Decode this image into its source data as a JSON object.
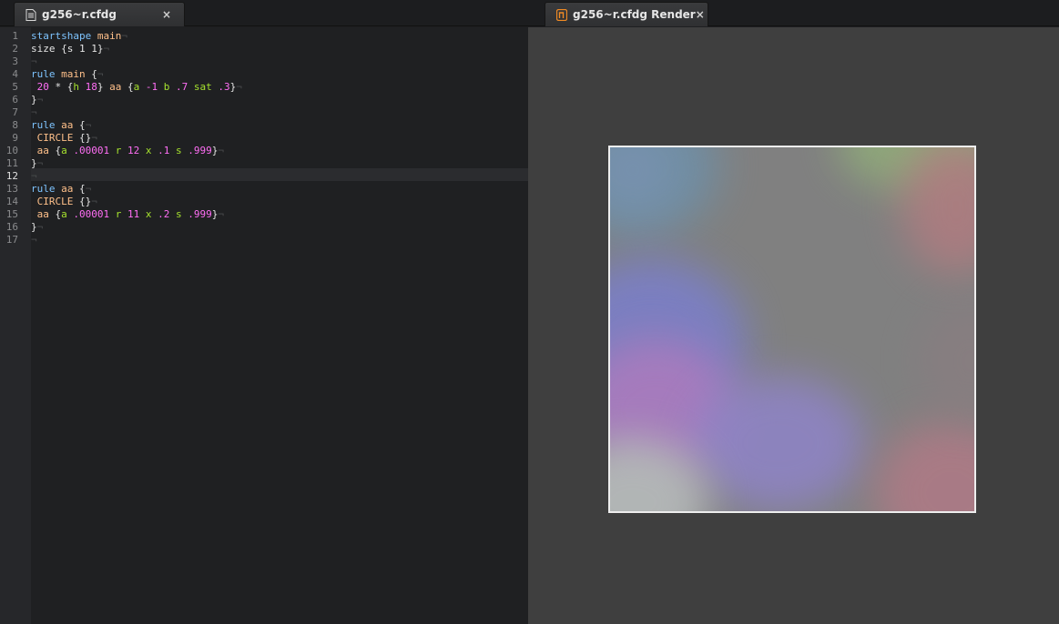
{
  "tabs": [
    {
      "label": "g256~r.cfdg",
      "icon": "document-icon",
      "close": "×"
    },
    {
      "label": "g256~r.cfdg Render",
      "icon": "render-app-icon",
      "close": "×"
    }
  ],
  "editor": {
    "active_line": 12,
    "line_numbers": [
      "1",
      "2",
      "3",
      "4",
      "5",
      "6",
      "7",
      "8",
      "9",
      "10",
      "11",
      "12",
      "13",
      "14",
      "15",
      "16",
      "17"
    ],
    "lines": [
      [
        {
          "t": "startshape",
          "c": "kw"
        },
        {
          "t": " "
        },
        {
          "t": "main",
          "c": "nm"
        }
      ],
      [
        {
          "t": "size {s 1 1}"
        }
      ],
      [],
      [
        {
          "t": "rule",
          "c": "kw"
        },
        {
          "t": " "
        },
        {
          "t": "main",
          "c": "nm"
        },
        {
          "t": " {"
        }
      ],
      [
        {
          "t": " "
        },
        {
          "t": "20",
          "c": "num"
        },
        {
          "t": " * {"
        },
        {
          "t": "h",
          "c": "key"
        },
        {
          "t": " "
        },
        {
          "t": "18",
          "c": "num"
        },
        {
          "t": "} "
        },
        {
          "t": "aa",
          "c": "id"
        },
        {
          "t": " {"
        },
        {
          "t": "a",
          "c": "key"
        },
        {
          "t": " "
        },
        {
          "t": "-1",
          "c": "num"
        },
        {
          "t": " "
        },
        {
          "t": "b",
          "c": "key"
        },
        {
          "t": " "
        },
        {
          "t": ".7",
          "c": "num"
        },
        {
          "t": " "
        },
        {
          "t": "sat",
          "c": "key"
        },
        {
          "t": " "
        },
        {
          "t": ".3",
          "c": "num"
        },
        {
          "t": "}"
        }
      ],
      [
        {
          "t": "}"
        }
      ],
      [],
      [
        {
          "t": "rule",
          "c": "kw"
        },
        {
          "t": " "
        },
        {
          "t": "aa",
          "c": "nm"
        },
        {
          "t": " {"
        }
      ],
      [
        {
          "t": " "
        },
        {
          "t": "CIRCLE",
          "c": "id"
        },
        {
          "t": " {}"
        }
      ],
      [
        {
          "t": " "
        },
        {
          "t": "aa",
          "c": "id"
        },
        {
          "t": " {"
        },
        {
          "t": "a",
          "c": "key"
        },
        {
          "t": " "
        },
        {
          "t": ".00001",
          "c": "num"
        },
        {
          "t": " "
        },
        {
          "t": "r",
          "c": "key"
        },
        {
          "t": " "
        },
        {
          "t": "12",
          "c": "num"
        },
        {
          "t": " "
        },
        {
          "t": "x",
          "c": "key"
        },
        {
          "t": " "
        },
        {
          "t": ".1",
          "c": "num"
        },
        {
          "t": " "
        },
        {
          "t": "s",
          "c": "key"
        },
        {
          "t": " "
        },
        {
          "t": ".999",
          "c": "num"
        },
        {
          "t": "}"
        }
      ],
      [
        {
          "t": "}"
        }
      ],
      [],
      [
        {
          "t": "rule",
          "c": "kw"
        },
        {
          "t": " "
        },
        {
          "t": "aa",
          "c": "nm"
        },
        {
          "t": " {"
        }
      ],
      [
        {
          "t": " "
        },
        {
          "t": "CIRCLE",
          "c": "id"
        },
        {
          "t": " {}"
        }
      ],
      [
        {
          "t": " "
        },
        {
          "t": "aa",
          "c": "id"
        },
        {
          "t": " {"
        },
        {
          "t": "a",
          "c": "key"
        },
        {
          "t": " "
        },
        {
          "t": ".00001",
          "c": "num"
        },
        {
          "t": " "
        },
        {
          "t": "r",
          "c": "key"
        },
        {
          "t": " "
        },
        {
          "t": "11",
          "c": "num"
        },
        {
          "t": " "
        },
        {
          "t": "x",
          "c": "key"
        },
        {
          "t": " "
        },
        {
          "t": ".2",
          "c": "num"
        },
        {
          "t": " "
        },
        {
          "t": "s",
          "c": "key"
        },
        {
          "t": " "
        },
        {
          "t": ".999",
          "c": "num"
        },
        {
          "t": "}"
        }
      ],
      [
        {
          "t": "}"
        }
      ],
      []
    ],
    "eol_marker": "¬"
  },
  "colors": {
    "keyword": "#7ec4ff",
    "name": "#ffc08a",
    "number": "#ff6ef5",
    "attribute": "#a6e22e",
    "render_background": "#3f3f3f",
    "render_canvas_base": "#808080"
  }
}
